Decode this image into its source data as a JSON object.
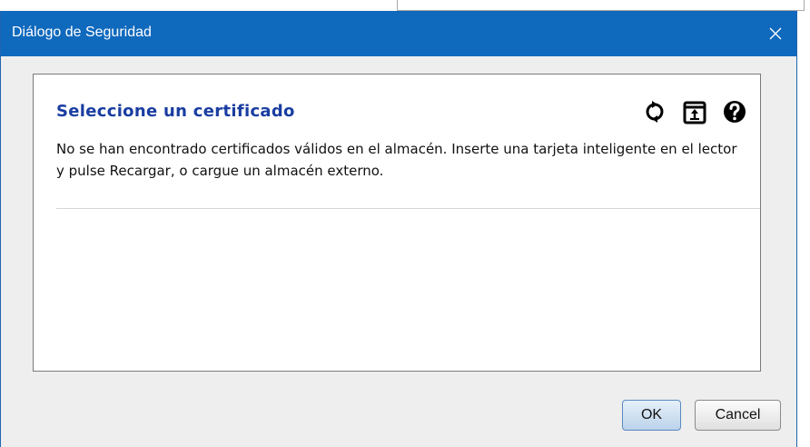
{
  "window": {
    "title": "Diálogo de Seguridad",
    "close_icon": "close-icon"
  },
  "panel": {
    "heading": "Seleccione un certificado",
    "message": "No se han encontrado certificados válidos en el almacén. Inserte una tarjeta inteligente en el lector y pulse Recargar, o cargue un almacén externo.",
    "toolbar": [
      {
        "icon": "reload-icon"
      },
      {
        "icon": "open-store-icon"
      },
      {
        "icon": "help-icon"
      }
    ]
  },
  "buttons": {
    "ok_label": "OK",
    "cancel_label": "Cancel"
  },
  "colors": {
    "titlebar": "#0f69bd",
    "heading": "#1a3da1",
    "dialog_bg": "#eeeeee"
  }
}
